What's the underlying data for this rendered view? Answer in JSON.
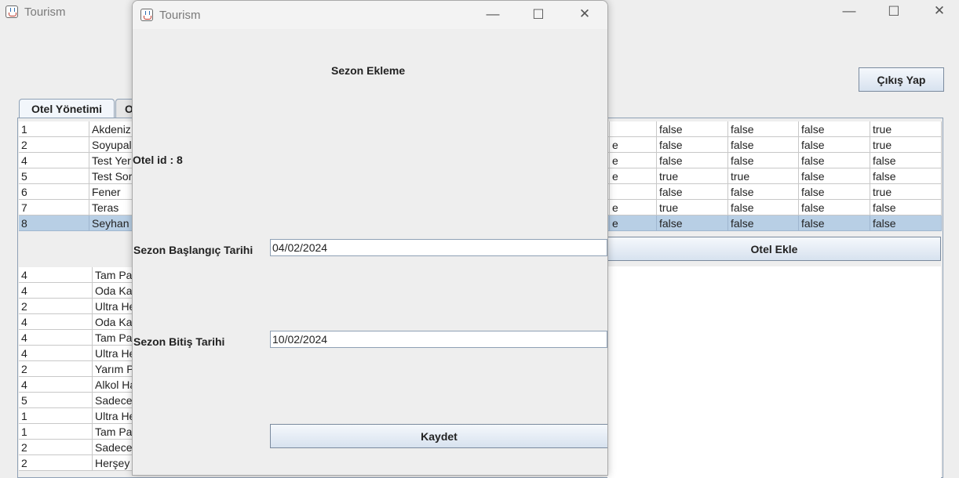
{
  "main_window": {
    "title": "Tourism",
    "logout_button": "Çıkış Yap",
    "tabs": [
      {
        "label": "Otel Yönetimi"
      },
      {
        "label": "O"
      }
    ],
    "add_hotel_button": "Otel Ekle",
    "hotels_table": {
      "rows": [
        {
          "id": "1",
          "name": "Akdeniz",
          "col_c": "",
          "f1": "false",
          "f2": "false",
          "f3": "false",
          "f4": "true",
          "selected": false
        },
        {
          "id": "2",
          "name": "Soyupal",
          "col_c": "e",
          "f1": "false",
          "f2": "false",
          "f3": "false",
          "f4": "true",
          "selected": false
        },
        {
          "id": "4",
          "name": "Test Yer",
          "col_c": "e",
          "f1": "false",
          "f2": "false",
          "f3": "false",
          "f4": "false",
          "selected": false
        },
        {
          "id": "5",
          "name": "Test Sor",
          "col_c": "e",
          "f1": "true",
          "f2": "true",
          "f3": "false",
          "f4": "false",
          "selected": false
        },
        {
          "id": "6",
          "name": "Fener",
          "col_c": "",
          "f1": "false",
          "f2": "false",
          "f3": "false",
          "f4": "true",
          "selected": false
        },
        {
          "id": "7",
          "name": "Teras",
          "col_c": "e",
          "f1": "true",
          "f2": "false",
          "f3": "false",
          "f4": "false",
          "selected": false
        },
        {
          "id": "8",
          "name": "Seyhan",
          "col_c": "e",
          "f1": "false",
          "f2": "false",
          "f3": "false",
          "f4": "false",
          "selected": true
        }
      ]
    },
    "pension_table": {
      "rows": [
        {
          "id": "4",
          "type": "Tam Pa"
        },
        {
          "id": "4",
          "type": "Oda Ka"
        },
        {
          "id": "2",
          "type": "Ultra He"
        },
        {
          "id": "4",
          "type": "Oda Ka"
        },
        {
          "id": "4",
          "type": "Tam Pa"
        },
        {
          "id": "4",
          "type": "Ultra He"
        },
        {
          "id": "2",
          "type": "Yarım P"
        },
        {
          "id": "4",
          "type": "Alkol Ha"
        },
        {
          "id": "5",
          "type": "Sadece"
        },
        {
          "id": "1",
          "type": "Ultra He"
        },
        {
          "id": "1",
          "type": "Tam Pa"
        },
        {
          "id": "2",
          "type": "Sadece"
        },
        {
          "id": "2",
          "type": "Herşey"
        }
      ]
    }
  },
  "dialog": {
    "title": "Tourism",
    "heading": "Sezon Ekleme",
    "hotel_id_label": "Otel id : 8",
    "start_label": "Sezon Başlangıç Tarihi",
    "start_value": "04/02/2024",
    "end_label": "Sezon Bitiş Tarihi",
    "end_value": "10/02/2024",
    "save_button": "Kaydet"
  },
  "icons": {
    "app": "java-cup-icon",
    "minimize": "minimize-icon",
    "maximize": "maximize-icon",
    "close": "close-icon"
  },
  "colors": {
    "selected_row": "#b8cfe5",
    "button_gradient_top": "#f5f8fc",
    "button_gradient_bottom": "#d7e2ef"
  }
}
